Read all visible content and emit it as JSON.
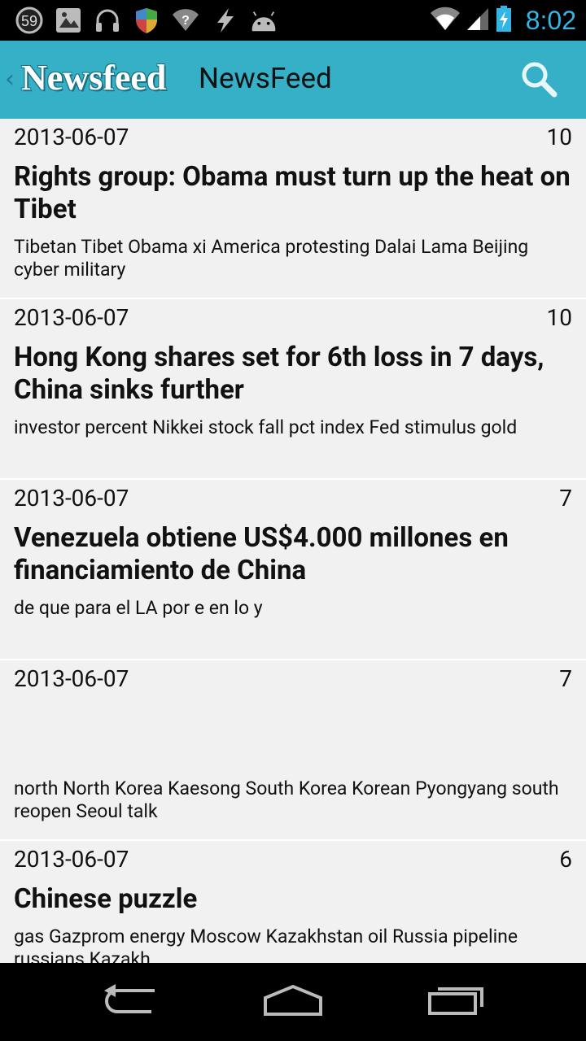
{
  "status_bar": {
    "notification_count": "59",
    "time": "8:02",
    "icons": [
      "notification-counter-icon",
      "gallery-icon",
      "headphones-icon",
      "shield-icon",
      "wifi-question-icon",
      "lightning-icon",
      "android-icon"
    ],
    "right_icons": [
      "wifi-signal-icon",
      "cell-signal-icon",
      "battery-charging-icon"
    ]
  },
  "action_bar": {
    "logo_text": "Newsfeed",
    "title": "NewsFeed",
    "search_icon": "search-icon",
    "accent_color": "#35b0c6"
  },
  "articles": [
    {
      "date": "2013-06-07",
      "count": "10",
      "title": "Rights group: Obama must turn up the heat on Tibet",
      "keywords": "Tibetan Tibet Obama xi America protesting Dalai Lama Beijing cyber military"
    },
    {
      "date": "2013-06-07",
      "count": "10",
      "title": "Hong Kong shares set for 6th loss in 7 days, China sinks further",
      "keywords": "investor percent Nikkei stock fall pct index Fed stimulus gold"
    },
    {
      "date": "2013-06-07",
      "count": "7",
      "title": "Venezuela obtiene US$4.000 millones en financiamiento de China",
      "keywords": "de que para el LA por e en lo y"
    },
    {
      "date": "2013-06-07",
      "count": "7",
      "title": "",
      "keywords": "north North Korea Kaesong South Korea Korean Pyongyang south reopen Seoul talk"
    },
    {
      "date": "2013-06-07",
      "count": "6",
      "title": "Chinese puzzle",
      "keywords": "gas Gazprom energy Moscow Kazakhstan oil Russia pipeline russians Kazakh"
    }
  ],
  "nav_bar": {
    "buttons": [
      "back-icon",
      "home-icon",
      "recent-apps-icon"
    ]
  }
}
